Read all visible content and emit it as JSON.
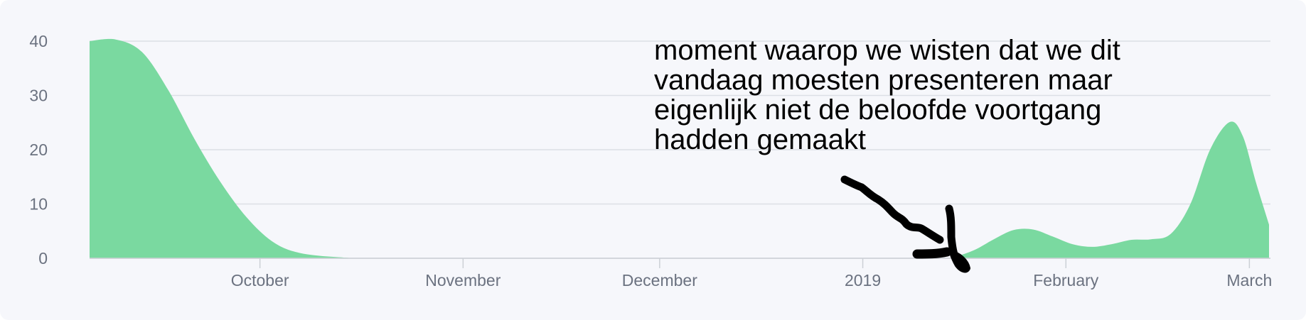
{
  "chart_data": {
    "type": "area",
    "series": [
      {
        "color": "#7ad9a0",
        "points": [
          {
            "x": "2018-09-05",
            "y": 40
          },
          {
            "x": "2018-09-09",
            "y": 40.3
          },
          {
            "x": "2018-09-13",
            "y": 38
          },
          {
            "x": "2018-09-17",
            "y": 31
          },
          {
            "x": "2018-09-21",
            "y": 22
          },
          {
            "x": "2018-09-25",
            "y": 14
          },
          {
            "x": "2018-09-29",
            "y": 7.5
          },
          {
            "x": "2018-10-03",
            "y": 3
          },
          {
            "x": "2018-10-07",
            "y": 1
          },
          {
            "x": "2018-10-13",
            "y": 0.2
          },
          {
            "x": "2018-10-20",
            "y": 0
          },
          {
            "x": "2018-11-15",
            "y": 0
          },
          {
            "x": "2018-12-15",
            "y": 0
          },
          {
            "x": "2019-01-12",
            "y": 0
          },
          {
            "x": "2019-01-15",
            "y": 0.3
          },
          {
            "x": "2019-01-18",
            "y": 1.5
          },
          {
            "x": "2019-01-21",
            "y": 3.5
          },
          {
            "x": "2019-01-24",
            "y": 5.2
          },
          {
            "x": "2019-01-27",
            "y": 5.3
          },
          {
            "x": "2019-01-30",
            "y": 4.0
          },
          {
            "x": "2019-02-02",
            "y": 2.6
          },
          {
            "x": "2019-02-05",
            "y": 2.1
          },
          {
            "x": "2019-02-08",
            "y": 2.6
          },
          {
            "x": "2019-02-11",
            "y": 3.4
          },
          {
            "x": "2019-02-14",
            "y": 3.5
          },
          {
            "x": "2019-02-17",
            "y": 4.5
          },
          {
            "x": "2019-02-20",
            "y": 10
          },
          {
            "x": "2019-02-23",
            "y": 20
          },
          {
            "x": "2019-02-26",
            "y": 25.1
          },
          {
            "x": "2019-02-28",
            "y": 22.5
          },
          {
            "x": "2019-03-02",
            "y": 14
          },
          {
            "x": "2019-03-04",
            "y": 6.2
          }
        ]
      }
    ],
    "xlim": [
      "2018-09-05",
      "2019-03-04"
    ],
    "ylim": [
      0,
      40
    ],
    "x_ticks": [
      {
        "label": "October",
        "date": "2018-10-01"
      },
      {
        "label": "November",
        "date": "2018-11-01"
      },
      {
        "label": "December",
        "date": "2018-12-01"
      },
      {
        "label": "2019",
        "date": "2019-01-01"
      },
      {
        "label": "February",
        "date": "2019-02-01"
      },
      {
        "label": "March",
        "date": "2019-03-01"
      }
    ],
    "y_ticks": [
      "0",
      "10",
      "20",
      "30",
      "40"
    ],
    "grid": true,
    "legend": "none",
    "annotation": "moment waarop we wisten dat we dit vandaag moesten presenteren maar eigenlijk niet de beloofde voortgang hadden gemaakt",
    "annotation_target_date": "2019-01-12"
  }
}
